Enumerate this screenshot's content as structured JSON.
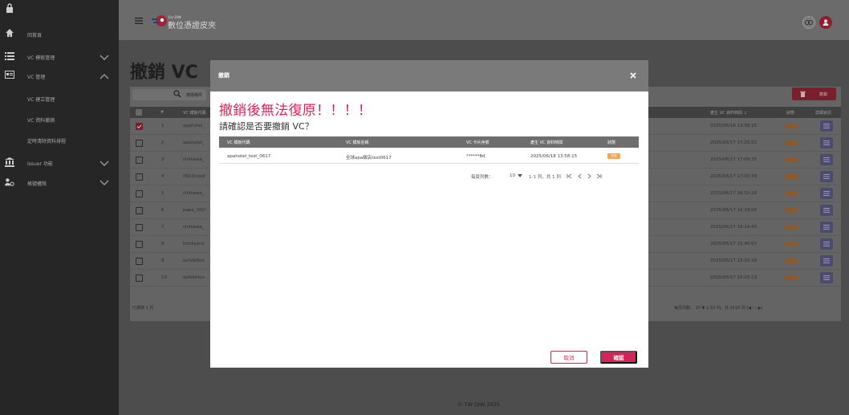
{
  "app": {
    "logo_sub": "For DIW",
    "logo_text": "數位憑證皮夾"
  },
  "sidebar": {
    "items": [
      {
        "label": "回首頁",
        "icon": "home-icon",
        "expandable": false
      },
      {
        "label": "VC 模板管理",
        "icon": "list-icon",
        "expandable": true,
        "expanded": false
      },
      {
        "label": "VC 管理",
        "icon": "id-card-icon",
        "expandable": true,
        "expanded": true
      },
      {
        "label": "VC 建立管理",
        "icon": "",
        "expandable": false
      },
      {
        "label": "VC 資料撤銷",
        "icon": "",
        "expandable": false
      },
      {
        "label": "定時清除資料排程",
        "icon": "",
        "expandable": false
      },
      {
        "label": "Issuer 功能",
        "icon": "bank-icon",
        "expandable": true,
        "expanded": false
      },
      {
        "label": "帳號權限",
        "icon": "users-gear-icon",
        "expandable": true,
        "expanded": false
      }
    ]
  },
  "page": {
    "title": "撤銷 VC",
    "search_label": "搜尋條件",
    "revoke_label": "撤銷",
    "table": {
      "headers": [
        "#",
        "VC 模板代碼",
        "產生 VC 資料時間 ↓",
        "狀態",
        "詳細資訊"
      ],
      "rows": [
        {
          "n": "1",
          "code": "apahotel_",
          "time": "2025/06/18 13:58:15",
          "checked": true
        },
        {
          "n": "2",
          "code": "apahotel_",
          "time": "2025/06/17 17:25:53",
          "checked": false
        },
        {
          "n": "3",
          "code": "chiikawa_",
          "time": "2025/06/17 17:09:35",
          "checked": false
        },
        {
          "n": "4",
          "code": "0613creat",
          "time": "2025/06/17 17:03:39",
          "checked": false
        },
        {
          "n": "5",
          "code": "chiikawa_",
          "time": "2025/06/17 16:52:16",
          "checked": false
        },
        {
          "n": "6",
          "code": "papa_202!",
          "time": "2025/06/17 16:19:04",
          "checked": false
        },
        {
          "n": "7",
          "code": "chiikawa_",
          "time": "2025/06/17 16:14:43",
          "checked": false
        },
        {
          "n": "8",
          "code": "biodiversi",
          "time": "2025/06/17 15:46:07",
          "checked": false
        },
        {
          "n": "9",
          "code": "exhibition",
          "time": "2025/06/17 15:30:16",
          "checked": false
        },
        {
          "n": "10",
          "code": "exhibition",
          "time": "2025/06/17 15:25:13",
          "checked": false
        }
      ],
      "selected_count": "已選擇 1 列",
      "pagination": "每頁列數： 10 ▼   1-10 列，共 2410 列   |◀   ‹   ›   ▶|"
    },
    "copyright": "© TW DIW 2025"
  },
  "modal": {
    "title": "撤銷",
    "close_icon": "close-icon",
    "warning": "撤銷後無法復原！！！！",
    "question": "請確認是否要撤銷 VC？",
    "headers": [
      "VC 模板代碼",
      "VC 模板名稱",
      "VC 卡片序號",
      "產生 VC 資料時間",
      "狀態"
    ],
    "row": {
      "code": "apahotel_test_0617",
      "name": "全球apa飯店test0617",
      "serial": "******8d",
      "time": "2025/06/18 13:58:15",
      "status": "有效"
    },
    "rows_per_page_label": "每頁列數：",
    "rows_per_page": "10",
    "range": "1-1 列，共 1 列",
    "cancel": "取消",
    "confirm": "確認"
  },
  "colors": {
    "accent": "#d6245a",
    "status": "#f2a65a",
    "header_bg": "#7a7a7a"
  }
}
